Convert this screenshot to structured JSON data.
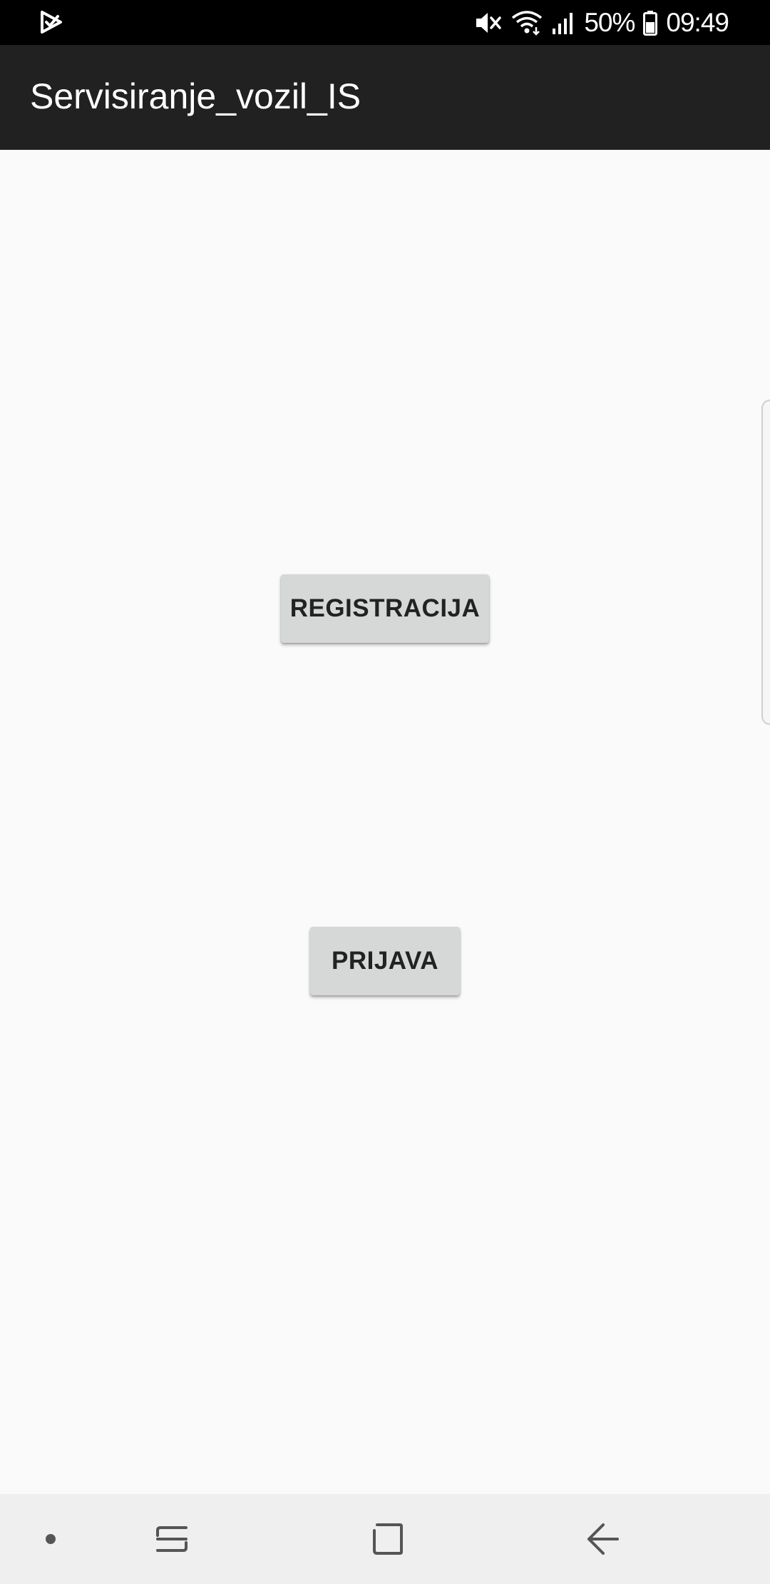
{
  "status_bar": {
    "left_icon": "play-store-notification-icon",
    "icons": [
      "mute-icon",
      "wifi-icon",
      "signal-icon"
    ],
    "battery_percent": "50%",
    "battery_icon": "battery-icon",
    "time": "09:49"
  },
  "app_bar": {
    "title": "Servisiranje_vozil_IS",
    "background_color": "#212121"
  },
  "main": {
    "register_button": "REGISTRACIJA",
    "login_button": "PRIJAVA",
    "button_color": "#d6d7d7"
  },
  "nav_bar": {
    "items": [
      "dot-icon",
      "recents-icon",
      "home-icon",
      "back-icon"
    ]
  }
}
